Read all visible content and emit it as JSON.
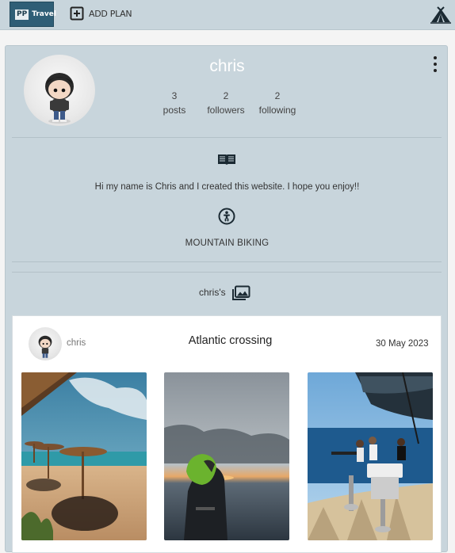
{
  "navbar": {
    "logo": {
      "badge": "PP",
      "text": "Travel"
    },
    "add_plan_label": "ADD PLAN",
    "icons": {
      "add": "plus-square-icon",
      "right": "tent-icon"
    }
  },
  "profile": {
    "username": "chris",
    "stats": [
      {
        "value": "3",
        "label": "posts"
      },
      {
        "value": "2",
        "label": "followers"
      },
      {
        "value": "2",
        "label": "following"
      }
    ],
    "bio_icon": "book-open-icon",
    "bio": "Hi my name is Chris and I created this website. I hope you enjoy!!",
    "activity_icon": "accessibility-icon",
    "activity": "MOUNTAIN BIKING",
    "gallery_label": "chris's",
    "gallery_icon": "photo-library-icon",
    "menu_icon": "kebab-menu-icon"
  },
  "post": {
    "user": "chris",
    "title": "Atlantic crossing",
    "date": "30 May 2023",
    "photos": [
      "beach with straw umbrellas",
      "person in green hood at sunset sea",
      "group on sailboat deck"
    ]
  },
  "colors": {
    "nav_bg": "#c8d5dc",
    "logo_bg": "#2f5e76",
    "card_bg": "#c8d5dc",
    "accent": "#1b2a33"
  }
}
